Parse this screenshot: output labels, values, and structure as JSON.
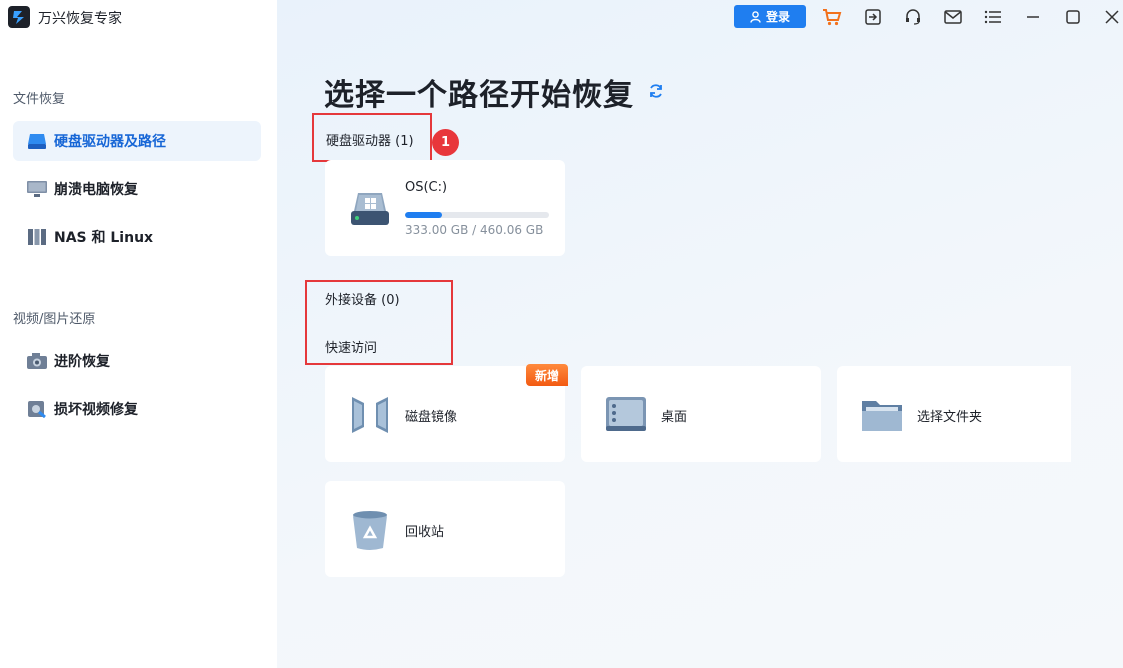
{
  "app": {
    "title": "万兴恢复专家"
  },
  "sidebar": {
    "section1": "文件恢复",
    "items1": [
      {
        "label": "硬盘驱动器及路径"
      },
      {
        "label": "崩溃电脑恢复"
      },
      {
        "label": "NAS 和 Linux"
      }
    ],
    "section2": "视频/图片还原",
    "items2": [
      {
        "label": "进阶恢复"
      },
      {
        "label": "损坏视频修复"
      }
    ]
  },
  "titlebar": {
    "login_label": "登录",
    "icons": [
      "cart-icon",
      "sign-in-icon",
      "headset-icon",
      "mail-icon",
      "menu-icon",
      "minimize-icon",
      "maximize-icon",
      "close-icon"
    ]
  },
  "main": {
    "title": "选择一个路径开始恢复",
    "hard_drives_label": "硬盘驱动器 (1)",
    "step_badge": "1",
    "drives": [
      {
        "name": "OS(C:)",
        "size": "333.00 GB / 460.06 GB",
        "used_fraction": 0.26
      }
    ],
    "external_label": "外接设备 (0)",
    "quick_access_label": "快速访问",
    "quick_items": [
      {
        "label": "磁盘镜像",
        "tag": "新增"
      },
      {
        "label": "桌面"
      },
      {
        "label": "选择文件夹"
      },
      {
        "label": "回收站"
      }
    ]
  },
  "colors": {
    "accent": "#1f7ef0",
    "highlight": "#e5383b",
    "new_tag": "#f25a12"
  }
}
